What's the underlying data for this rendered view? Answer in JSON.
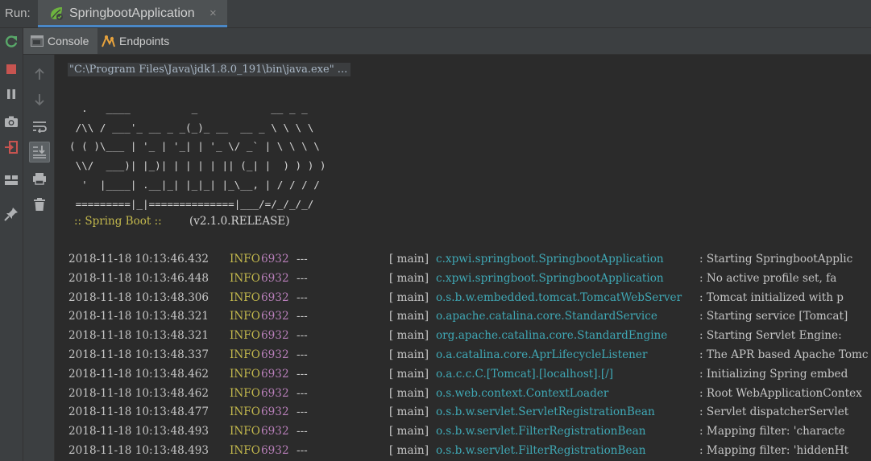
{
  "runbar": {
    "label": "Run:",
    "tab_title": "SpringbootApplication",
    "close_glyph": "×"
  },
  "left_toolbar": [
    "rerun-icon",
    "stop-icon",
    "pause-icon",
    "camera-icon",
    "exit-icon",
    "layout-icon",
    "pin-icon"
  ],
  "subtabs": [
    {
      "label": "Console",
      "icon": "console-icon"
    },
    {
      "label": "Endpoints",
      "icon": "endpoints-icon"
    }
  ],
  "console_toolbar": [
    "up-arrow-icon",
    "down-arrow-icon",
    "soft-wrap-icon",
    "scroll-to-end-icon",
    "print-icon",
    "trash-icon"
  ],
  "colors": {
    "background": "#2b2b2b",
    "panel": "#3c3f41",
    "tab_underline": "#4a88c7",
    "log_level": "#c4b94d",
    "pid": "#b87fb9",
    "logger": "#3fa8b5"
  },
  "console": {
    "command": "\"C:\\Program Files\\Java\\jdk1.8.0_191\\bin\\java.exe\" ...",
    "banner": [
      "  .   ____          _            __ _ _",
      " /\\\\ / ___'_ __ _ _(_)_ __  __ _ \\ \\ \\ \\",
      "( ( )\\___ | '_ | '_| | '_ \\/ _` | \\ \\ \\ \\",
      " \\\\/  ___)| |_)| | | | | || (_| |  ) ) ) )",
      "  '  |____| .__|_| |_|_| |_\\__, | / / / /",
      " =========|_|==============|___/=/_/_/_/"
    ],
    "boot_name": ":: Spring Boot ::",
    "boot_version": "(v2.1.0.RELEASE)",
    "logs": [
      {
        "ts": "2018-11-18 10:13:46.432",
        "level": "INFO",
        "pid": "6932",
        "sep": "---",
        "thread": "[           main]",
        "logger": "c.xpwi.springboot.SpringbootApplication",
        "msg": ": Starting SpringbootApplic"
      },
      {
        "ts": "2018-11-18 10:13:46.448",
        "level": "INFO",
        "pid": "6932",
        "sep": "---",
        "thread": "[           main]",
        "logger": "c.xpwi.springboot.SpringbootApplication",
        "msg": ": No active profile set, fa"
      },
      {
        "ts": "2018-11-18 10:13:48.306",
        "level": "INFO",
        "pid": "6932",
        "sep": "---",
        "thread": "[           main]",
        "logger": "o.s.b.w.embedded.tomcat.TomcatWebServer",
        "msg": ": Tomcat initialized with p"
      },
      {
        "ts": "2018-11-18 10:13:48.321",
        "level": "INFO",
        "pid": "6932",
        "sep": "---",
        "thread": "[           main]",
        "logger": "o.apache.catalina.core.StandardService",
        "msg": ": Starting service [Tomcat]"
      },
      {
        "ts": "2018-11-18 10:13:48.321",
        "level": "INFO",
        "pid": "6932",
        "sep": "---",
        "thread": "[           main]",
        "logger": "org.apache.catalina.core.StandardEngine",
        "msg": ": Starting Servlet Engine: "
      },
      {
        "ts": "2018-11-18 10:13:48.337",
        "level": "INFO",
        "pid": "6932",
        "sep": "---",
        "thread": "[           main]",
        "logger": "o.a.catalina.core.AprLifecycleListener",
        "msg": ": The APR based Apache Tomc"
      },
      {
        "ts": "2018-11-18 10:13:48.462",
        "level": "INFO",
        "pid": "6932",
        "sep": "---",
        "thread": "[           main]",
        "logger": "o.a.c.c.C.[Tomcat].[localhost].[/]",
        "msg": ": Initializing Spring embed"
      },
      {
        "ts": "2018-11-18 10:13:48.462",
        "level": "INFO",
        "pid": "6932",
        "sep": "---",
        "thread": "[           main]",
        "logger": "o.s.web.context.ContextLoader",
        "msg": ": Root WebApplicationContex"
      },
      {
        "ts": "2018-11-18 10:13:48.477",
        "level": "INFO",
        "pid": "6932",
        "sep": "---",
        "thread": "[           main]",
        "logger": "o.s.b.w.servlet.ServletRegistrationBean",
        "msg": ": Servlet dispatcherServlet"
      },
      {
        "ts": "2018-11-18 10:13:48.493",
        "level": "INFO",
        "pid": "6932",
        "sep": "---",
        "thread": "[           main]",
        "logger": "o.s.b.w.servlet.FilterRegistrationBean",
        "msg": ": Mapping filter: 'characte"
      },
      {
        "ts": "2018-11-18 10:13:48.493",
        "level": "INFO",
        "pid": "6932",
        "sep": "---",
        "thread": "[           main]",
        "logger": "o.s.b.w.servlet.FilterRegistrationBean",
        "msg": ": Mapping filter: 'hiddenHt"
      }
    ]
  }
}
